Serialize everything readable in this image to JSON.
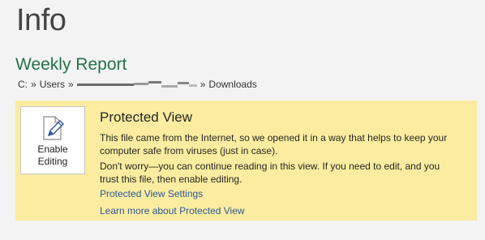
{
  "page": {
    "title": "Info"
  },
  "document": {
    "title": "Weekly Report",
    "path": {
      "drive": "C:",
      "separator": "»",
      "users": "Users",
      "folder": "Downloads"
    }
  },
  "protected_view": {
    "button_label": "Enable\nEditing",
    "title": "Protected View",
    "message_1": "This file came from the Internet, so we opened it in a way that helps to keep your computer safe from viruses (just in case).",
    "message_2": "Don't worry—you can continue reading in this view. If you need to edit, and you trust this file, then enable editing.",
    "settings_link": "Protected View Settings",
    "learn_more_link": "Learn more about Protected View",
    "banner_color": "#fbec9f",
    "link_color": "#2b579a",
    "title_color": "#217346"
  }
}
